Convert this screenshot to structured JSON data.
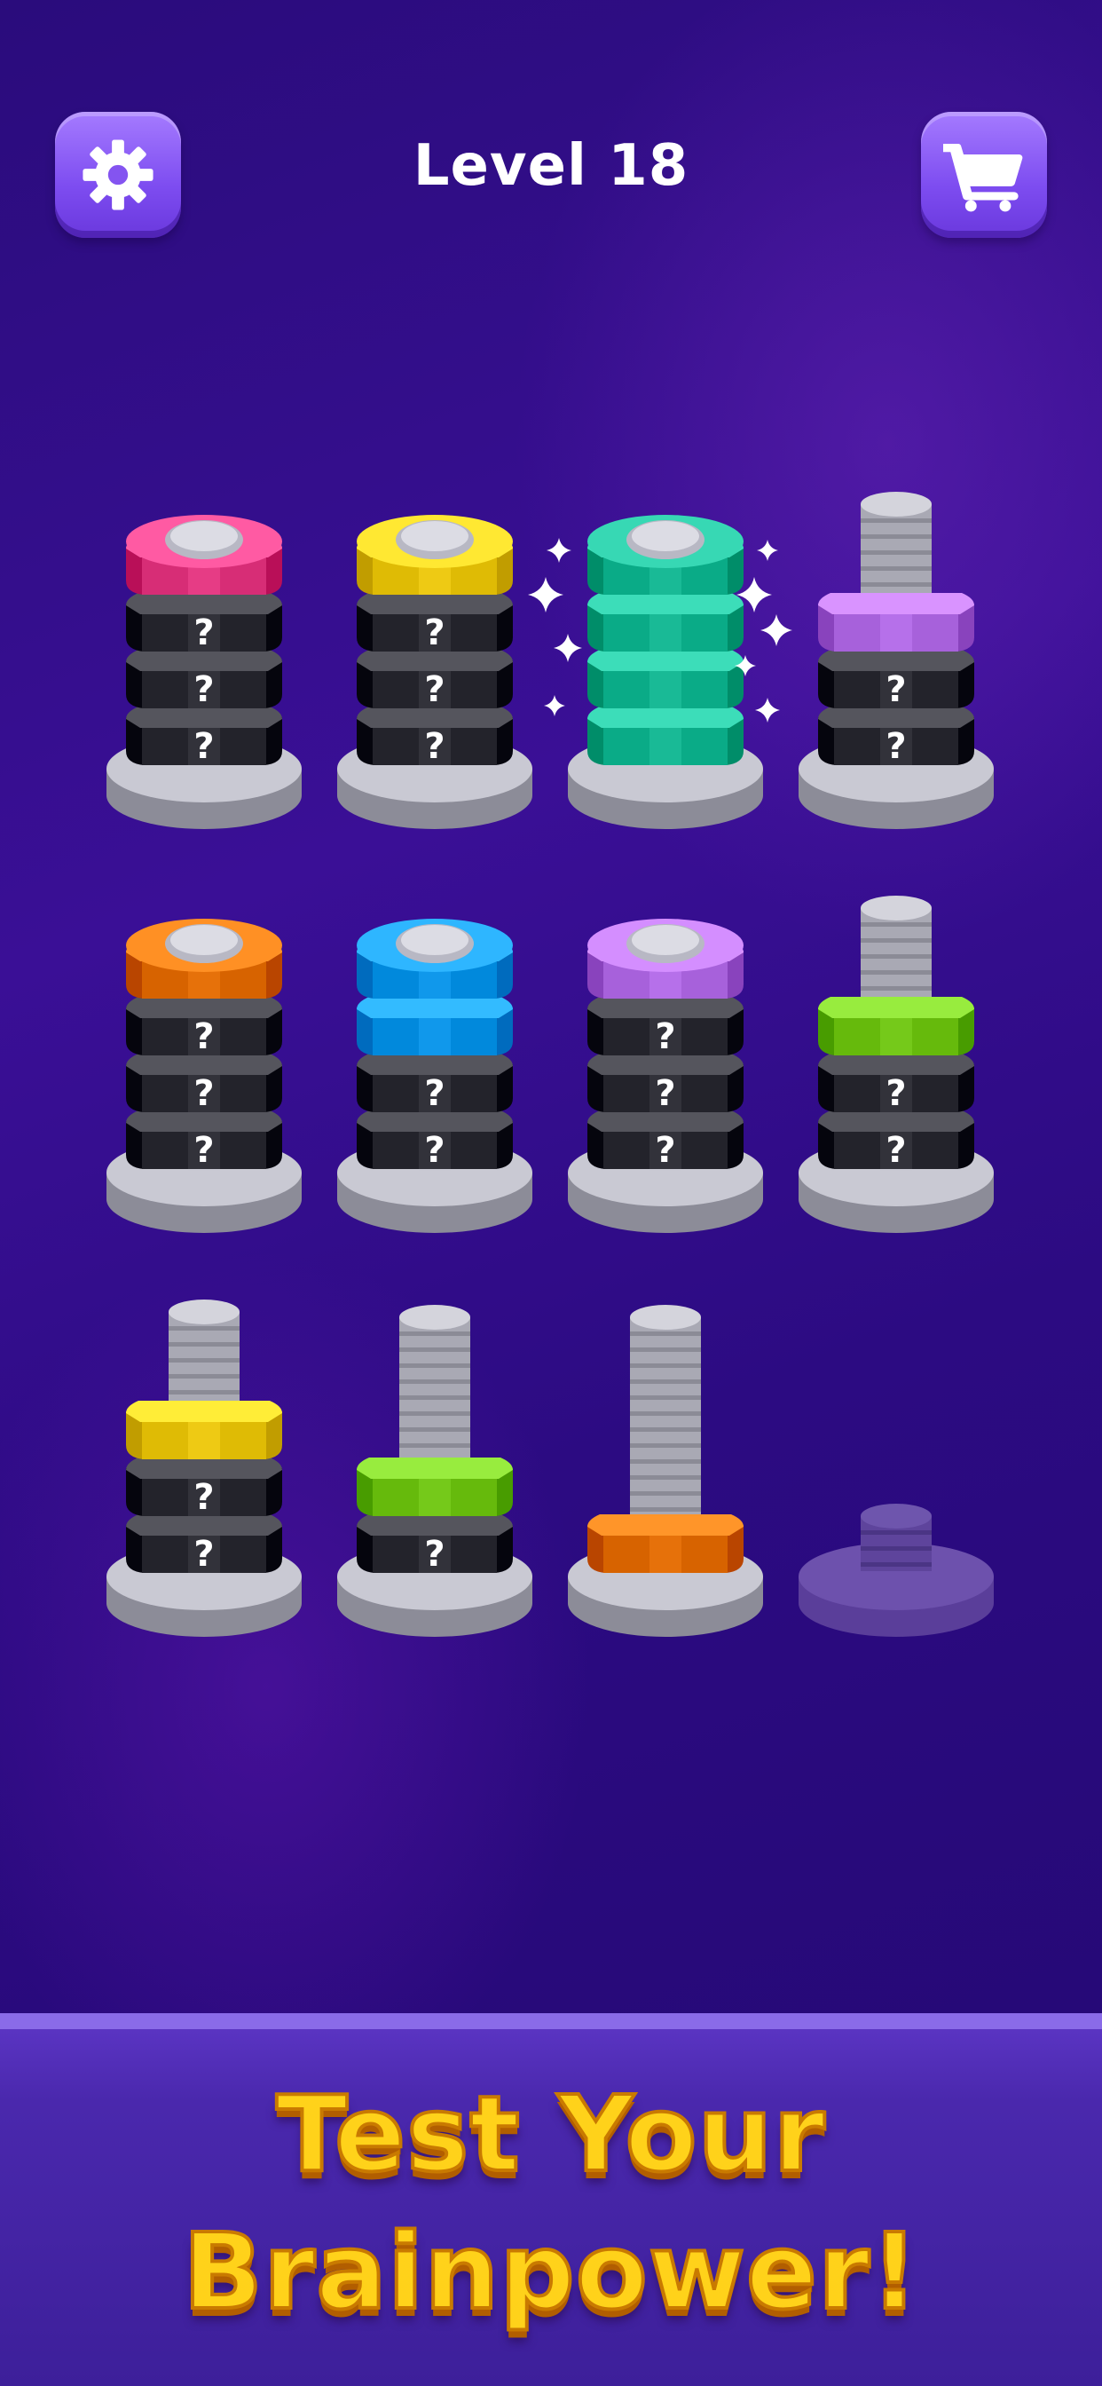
{
  "header": {
    "level_title": "Level 18",
    "settings_icon": "gear-icon",
    "shop_icon": "cart-icon"
  },
  "colors": {
    "pink": "#f0468f",
    "yellow": "#f8d41e",
    "teal": "#23c4a0",
    "purple": "#c07af4",
    "orange": "#f07c10",
    "blue": "#1aa2f5",
    "green": "#7fd325",
    "hidden": "#3c3c44",
    "button": "#8a5cf5",
    "tagline": "#ffd21a"
  },
  "hidden_label": "?",
  "poles": [
    {
      "id": "pole-1",
      "nuts": [
        "hidden",
        "hidden",
        "hidden",
        "pink"
      ],
      "capacity": 4
    },
    {
      "id": "pole-2",
      "nuts": [
        "hidden",
        "hidden",
        "hidden",
        "yellow"
      ],
      "capacity": 4
    },
    {
      "id": "pole-3",
      "nuts": [
        "teal",
        "teal",
        "teal",
        "teal"
      ],
      "capacity": 4,
      "completed": true
    },
    {
      "id": "pole-4",
      "nuts": [
        "hidden",
        "hidden",
        "purple"
      ],
      "capacity": 4
    },
    {
      "id": "pole-5",
      "nuts": [
        "hidden",
        "hidden",
        "hidden",
        "orange"
      ],
      "capacity": 4
    },
    {
      "id": "pole-6",
      "nuts": [
        "hidden",
        "hidden",
        "blue",
        "blue"
      ],
      "capacity": 4
    },
    {
      "id": "pole-7",
      "nuts": [
        "hidden",
        "hidden",
        "hidden",
        "purple"
      ],
      "capacity": 4
    },
    {
      "id": "pole-8",
      "nuts": [
        "hidden",
        "hidden",
        "green"
      ],
      "capacity": 4
    },
    {
      "id": "pole-9",
      "nuts": [
        "hidden",
        "hidden",
        "yellow"
      ],
      "capacity": 4
    },
    {
      "id": "pole-10",
      "nuts": [
        "hidden",
        "green"
      ],
      "capacity": 4
    },
    {
      "id": "pole-11",
      "nuts": [
        "orange"
      ],
      "capacity": 4
    },
    {
      "id": "pole-12",
      "nuts": [],
      "capacity": 4,
      "locked": true
    }
  ],
  "banner": {
    "line1": "Test Your",
    "line2": "Brainpower!"
  }
}
